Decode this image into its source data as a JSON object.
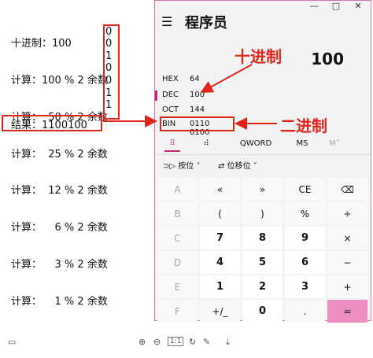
{
  "left_panel": {
    "header": "十进制：100",
    "lines": [
      "计算：100 % 2 余数",
      "计算：  50 % 2 余数",
      "计算：  25 % 2 余数",
      "计算：  12 % 2 余数",
      "计算：    6 % 2 余数",
      "计算：    3 % 2 余数",
      "计算：    1 % 2 余数"
    ],
    "remainders": [
      "0",
      "0",
      "1",
      "0",
      "0",
      "1",
      "1"
    ],
    "result": "结果：1100100"
  },
  "annotations": {
    "decimal_label": "十进制",
    "binary_label": "二进制",
    "color": "#e0261a"
  },
  "calculator": {
    "window_controls": [
      "—",
      "□",
      "✕"
    ],
    "menu_icon": "hamburger-icon",
    "mode_title": "程序员",
    "display_value": "100",
    "bases": [
      {
        "label": "HEX",
        "value": "64"
      },
      {
        "label": "DEC",
        "value": "100"
      },
      {
        "label": "OCT",
        "value": "144"
      },
      {
        "label": "BIN",
        "value": "0110 0100"
      }
    ],
    "tabs": [
      {
        "label": "⠿",
        "icon": "keypad-icon"
      },
      {
        "label": "⠾",
        "icon": "bit-toggle-icon"
      },
      {
        "label": "QWORD"
      },
      {
        "label": "MS"
      },
      {
        "label": "M˅"
      }
    ],
    "ops": [
      {
        "icon": "bitwise-icon",
        "label": "按位",
        "chevron": "˅"
      },
      {
        "icon": "bitshift-icon",
        "label": "位移位",
        "chevron": "˅"
      }
    ],
    "keys": [
      [
        "A",
        "«",
        "»",
        "CE",
        "⌫"
      ],
      [
        "B",
        "(",
        ")",
        "%",
        "÷"
      ],
      [
        "C",
        "7",
        "8",
        "9",
        "×"
      ],
      [
        "D",
        "4",
        "5",
        "6",
        "−"
      ],
      [
        "E",
        "1",
        "2",
        "3",
        "+"
      ],
      [
        "F",
        "+/_",
        "0",
        ".",
        "="
      ]
    ],
    "accent_color": "#c5237a",
    "equals_color": "#ec8ec1"
  },
  "toolbar": {
    "icons": [
      "tray-icon",
      "zoom-in-icon",
      "zoom-out-icon",
      "actual-size-icon",
      "rotate-icon",
      "edit-icon",
      "download-icon"
    ],
    "actual_size_label": "1:1"
  }
}
